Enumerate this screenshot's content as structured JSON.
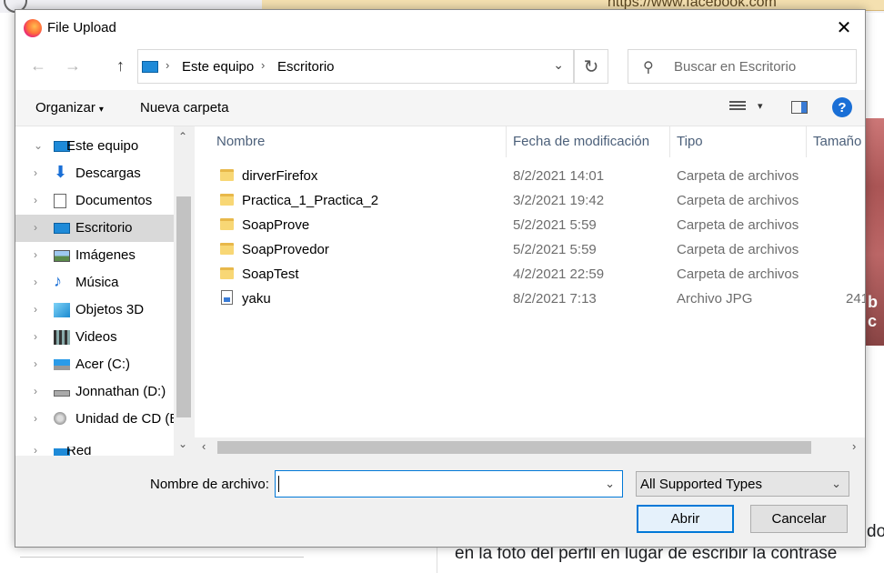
{
  "background": {
    "url": "https://www.facebook.com",
    "right_text": "b c",
    "bottom_text": "en la foto del perfil en lugar de escribir la contrase",
    "bottom_text2": "do"
  },
  "dialog": {
    "title": "File Upload",
    "close": "✕"
  },
  "navigation": {
    "back": "←",
    "forward": "→",
    "up": "↑",
    "breadcrumb": [
      "Este equipo",
      "Escritorio"
    ],
    "separator": "›",
    "dropdown": "⌄",
    "refresh": "↻",
    "search_placeholder": "Buscar en Escritorio",
    "search_icon": "⚲"
  },
  "commands": {
    "organize": "Organizar",
    "organize_arrow": "▾",
    "new_folder": "Nueva carpeta",
    "view_dropdown": "▾",
    "help": "?"
  },
  "nav_pane": {
    "items": [
      {
        "label": "Este equipo",
        "icon": "pc-icon",
        "chevron": "⌄"
      },
      {
        "label": "Descargas",
        "icon": "download-icon",
        "chevron": "›"
      },
      {
        "label": "Documentos",
        "icon": "documents-icon",
        "chevron": "›"
      },
      {
        "label": "Escritorio",
        "icon": "desktop-icon",
        "chevron": "›",
        "selected": true
      },
      {
        "label": "Imágenes",
        "icon": "pictures-icon",
        "chevron": "›"
      },
      {
        "label": "Música",
        "icon": "music-icon",
        "chevron": "›"
      },
      {
        "label": "Objetos 3D",
        "icon": "3d-objects-icon",
        "chevron": "›"
      },
      {
        "label": "Videos",
        "icon": "videos-icon",
        "chevron": "›"
      },
      {
        "label": "Acer (C:)",
        "icon": "windows-drive-icon",
        "chevron": "›"
      },
      {
        "label": "Jonnathan (D:)",
        "icon": "drive-icon",
        "chevron": "›"
      },
      {
        "label": "Unidad de CD (E",
        "icon": "cd-drive-icon",
        "chevron": "›"
      },
      {
        "label": "Red",
        "icon": "network-icon",
        "chevron": "›"
      }
    ],
    "scroll_up": "⌃",
    "scroll_down": "⌄"
  },
  "file_list": {
    "sort_indicator": "^",
    "columns": {
      "name": "Nombre",
      "date": "Fecha de modificación",
      "type": "Tipo",
      "size": "Tamaño"
    },
    "rows": [
      {
        "name": "dirverFirefox",
        "date": "8/2/2021 14:01",
        "type": "Carpeta de archivos",
        "size": "",
        "kind": "folder"
      },
      {
        "name": "Practica_1_Practica_2",
        "date": "3/2/2021 19:42",
        "type": "Carpeta de archivos",
        "size": "",
        "kind": "folder"
      },
      {
        "name": "SoapProve",
        "date": "5/2/2021 5:59",
        "type": "Carpeta de archivos",
        "size": "",
        "kind": "folder"
      },
      {
        "name": "SoapProvedor",
        "date": "5/2/2021 5:59",
        "type": "Carpeta de archivos",
        "size": "",
        "kind": "folder"
      },
      {
        "name": "SoapTest",
        "date": "4/2/2021 22:59",
        "type": "Carpeta de archivos",
        "size": "",
        "kind": "folder"
      },
      {
        "name": "yaku",
        "date": "8/2/2021 7:13",
        "type": "Archivo JPG",
        "size": "241",
        "kind": "jpg"
      }
    ],
    "scroll_left": "‹",
    "scroll_right": "›"
  },
  "bottom": {
    "filename_label": "Nombre de archivo:",
    "filename_value": "",
    "filename_dropdown": "⌄",
    "filetype": "All Supported Types",
    "filetype_dropdown": "⌄",
    "open": "Abrir",
    "cancel": "Cancelar"
  }
}
